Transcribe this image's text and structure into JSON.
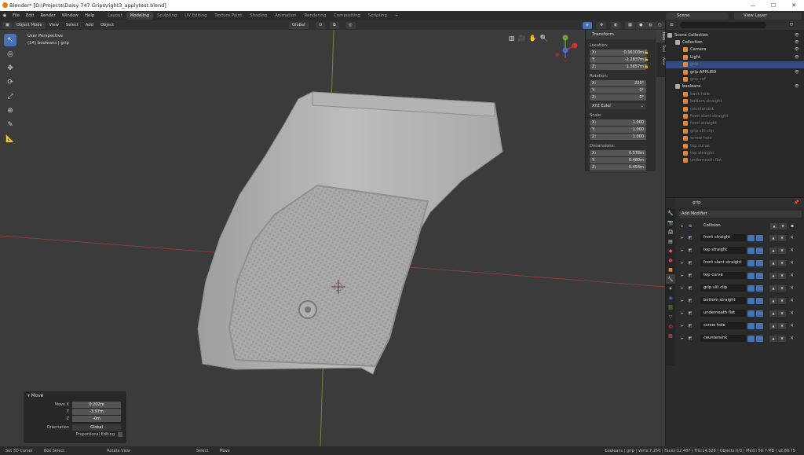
{
  "title": "Blender* [D:\\Projects\\Daisy 747 Grips\\right3_applytest.blend]",
  "window_controls": {
    "min": "—",
    "max": "☐",
    "close": "✕"
  },
  "menus": [
    "File",
    "Edit",
    "Render",
    "Window",
    "Help"
  ],
  "workspaces": [
    "Layout",
    "Modeling",
    "Sculpting",
    "UV Editing",
    "Texture Paint",
    "Shading",
    "Animation",
    "Rendering",
    "Compositing",
    "Scripting",
    "+"
  ],
  "active_workspace": "Modeling",
  "scene": "Scene",
  "view_layer": "View Layer",
  "viewport_header": {
    "mode": "Object Mode",
    "view": "View",
    "select": "Select",
    "add": "Add",
    "object": "Object",
    "orientation": "Global"
  },
  "viewport_info": {
    "line1": "User Perspective",
    "line2": "(14) booleans | grip"
  },
  "npanel": {
    "title": "Transform",
    "location_label": "Location:",
    "location": [
      {
        "axis": "X:",
        "val": "0.16103m"
      },
      {
        "axis": "Y:",
        "val": "-1.2837m"
      },
      {
        "axis": "Z:",
        "val": "1.3657m"
      }
    ],
    "rotation_label": "Rotation:",
    "rotation": [
      {
        "axis": "X:",
        "val": "220°"
      },
      {
        "axis": "Y:",
        "val": "0°"
      },
      {
        "axis": "Z:",
        "val": "0°"
      }
    ],
    "euler": "XYZ Euler",
    "scale_label": "Scale:",
    "scale": [
      {
        "axis": "X:",
        "val": "1.000"
      },
      {
        "axis": "Y:",
        "val": "1.000"
      },
      {
        "axis": "Z:",
        "val": "1.000"
      }
    ],
    "dimensions_label": "Dimensions:",
    "dimensions": [
      {
        "axis": "X:",
        "val": "0.578m"
      },
      {
        "axis": "Y:",
        "val": "0.480m"
      },
      {
        "axis": "Z:",
        "val": "0.454m"
      }
    ],
    "tabs": [
      "Item",
      "Tool",
      "View"
    ]
  },
  "move_panel": {
    "title": "Move",
    "rows": [
      {
        "label": "Move X",
        "val": "0.202m"
      },
      {
        "label": "Y",
        "val": "-3.97m"
      },
      {
        "label": "Z",
        "val": "-0m"
      },
      {
        "label": "Orientation",
        "val": "Global"
      }
    ],
    "proportional": "Proportional Editing"
  },
  "statusbar": {
    "items": [
      "Set 3D Cursor",
      "Box Select",
      "Rotate View",
      "Select",
      "Move"
    ],
    "stats": "booleans | grip | Verts:7,250 | Faces:12,487 | Tris:14,528 | Objects:0/3 | Mem: 50.7 MB | v2.80.75"
  },
  "outliner": {
    "items": [
      {
        "name": "Scene Collection",
        "indent": 2,
        "color": "#aaaaaa",
        "dim": false,
        "sel": false
      },
      {
        "name": "Collection",
        "indent": 12,
        "color": "#aaaaaa",
        "dim": false,
        "sel": false
      },
      {
        "name": "Camera",
        "indent": 22,
        "color": "#e0893b",
        "dim": false,
        "sel": false
      },
      {
        "name": "Light",
        "indent": 22,
        "color": "#e0893b",
        "dim": false,
        "sel": false
      },
      {
        "name": "grip",
        "indent": 22,
        "color": "#e0893b",
        "dim": true,
        "sel": true
      },
      {
        "name": "grip APPLIED",
        "indent": 22,
        "color": "#e0893b",
        "dim": false,
        "sel": false
      },
      {
        "name": "grip_ref",
        "indent": 22,
        "color": "#e0893b",
        "dim": true,
        "sel": false
      },
      {
        "name": "booleans",
        "indent": 12,
        "color": "#aaaaaa",
        "dim": false,
        "sel": false
      },
      {
        "name": "back hole",
        "indent": 22,
        "color": "#e0893b",
        "dim": true,
        "sel": false
      },
      {
        "name": "bottom straight",
        "indent": 22,
        "color": "#e0893b",
        "dim": true,
        "sel": false
      },
      {
        "name": "countersink",
        "indent": 22,
        "color": "#e0893b",
        "dim": true,
        "sel": false
      },
      {
        "name": "front slant straight",
        "indent": 22,
        "color": "#e0893b",
        "dim": true,
        "sel": false
      },
      {
        "name": "front straight",
        "indent": 22,
        "color": "#e0893b",
        "dim": true,
        "sel": false
      },
      {
        "name": "grip slit clip",
        "indent": 22,
        "color": "#e0893b",
        "dim": true,
        "sel": false
      },
      {
        "name": "screw hole",
        "indent": 22,
        "color": "#e0893b",
        "dim": true,
        "sel": false
      },
      {
        "name": "top curve",
        "indent": 22,
        "color": "#e0893b",
        "dim": true,
        "sel": false
      },
      {
        "name": "top straight",
        "indent": 22,
        "color": "#e0893b",
        "dim": true,
        "sel": false
      },
      {
        "name": "underneath flat",
        "indent": 22,
        "color": "#e0893b",
        "dim": true,
        "sel": false
      }
    ]
  },
  "properties": {
    "object": "grip",
    "add_modifier": "Add Modifier",
    "collision": "Collision",
    "modifiers": [
      "front straight",
      "top straight",
      "front slant straight",
      "top curve",
      "grip slit clip",
      "bottom straight",
      "underneath flat",
      "screw hole",
      "countersink"
    ]
  },
  "colors": {
    "accent": "#4772b3",
    "selected": "#334d80",
    "object_orange": "#e0893b"
  }
}
